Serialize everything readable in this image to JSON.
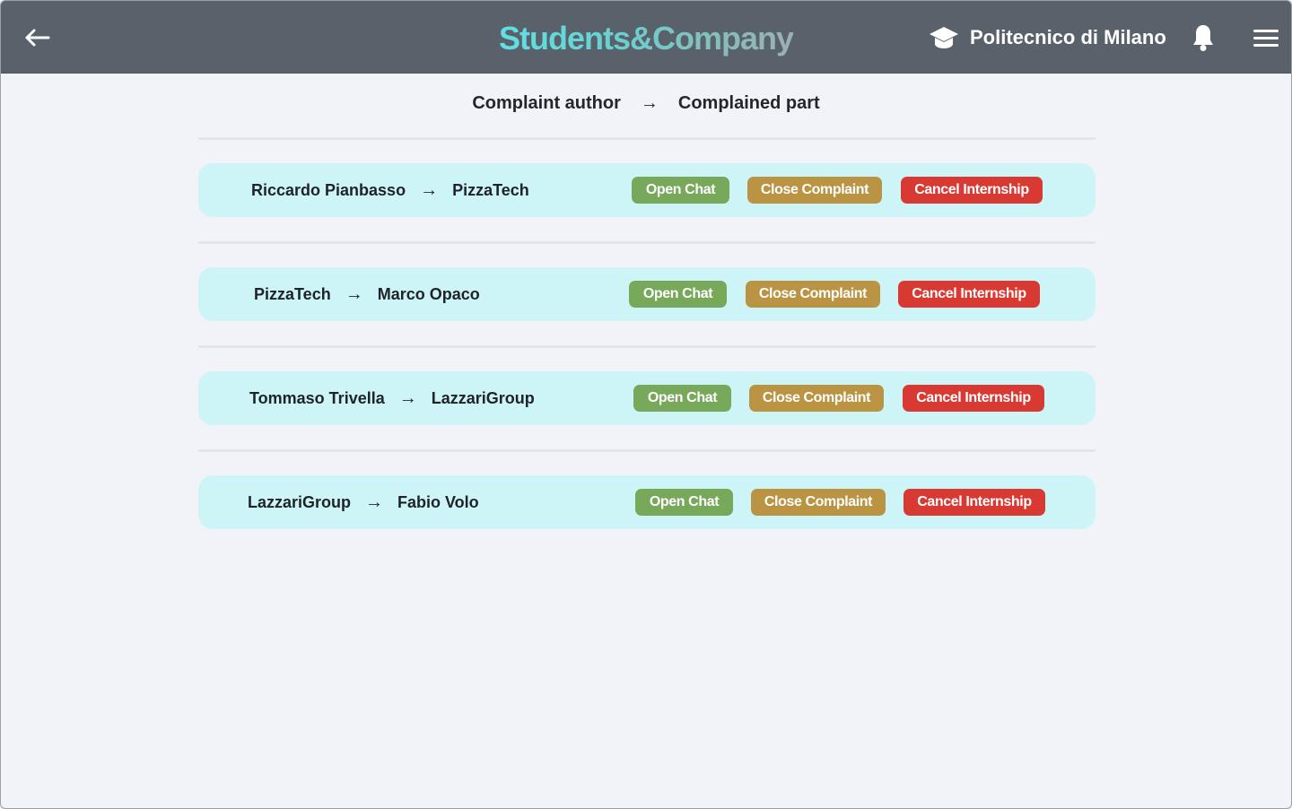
{
  "topbar": {
    "brand": "Students&Company",
    "university": "Politecnico di Milano",
    "icons": {
      "back": "arrow-left-icon",
      "university": "graduation-cap-icon",
      "notifications": "bell-icon",
      "menu": "hamburger-menu-icon"
    }
  },
  "header": {
    "author_label": "Complaint author",
    "arrow": "→",
    "complained_label": "Complained part"
  },
  "complaints": [
    {
      "author": "Riccardo Pianbasso",
      "arrow": "→",
      "complained": "PizzaTech",
      "open_chat": "Open Chat",
      "close_complaint": "Close Complaint",
      "cancel_internship": "Cancel Internship"
    },
    {
      "author": "PizzaTech",
      "arrow": "→",
      "complained": "Marco Opaco",
      "open_chat": "Open Chat",
      "close_complaint": "Close Complaint",
      "cancel_internship": "Cancel Internship"
    },
    {
      "author": "Tommaso Trivella",
      "arrow": "→",
      "complained": "LazzariGroup",
      "open_chat": "Open Chat",
      "close_complaint": "Close Complaint",
      "cancel_internship": "Cancel Internship"
    },
    {
      "author": "LazzariGroup",
      "arrow": "→",
      "complained": "Fabio Volo",
      "open_chat": "Open Chat",
      "close_complaint": "Close Complaint",
      "cancel_internship": "Cancel Internship"
    }
  ],
  "colors": {
    "topbar": "#59626b",
    "card": "#cdf4f6",
    "open_chat": "#78a85a",
    "close_complaint": "#bb9443",
    "cancel_internship": "#d83a33"
  }
}
